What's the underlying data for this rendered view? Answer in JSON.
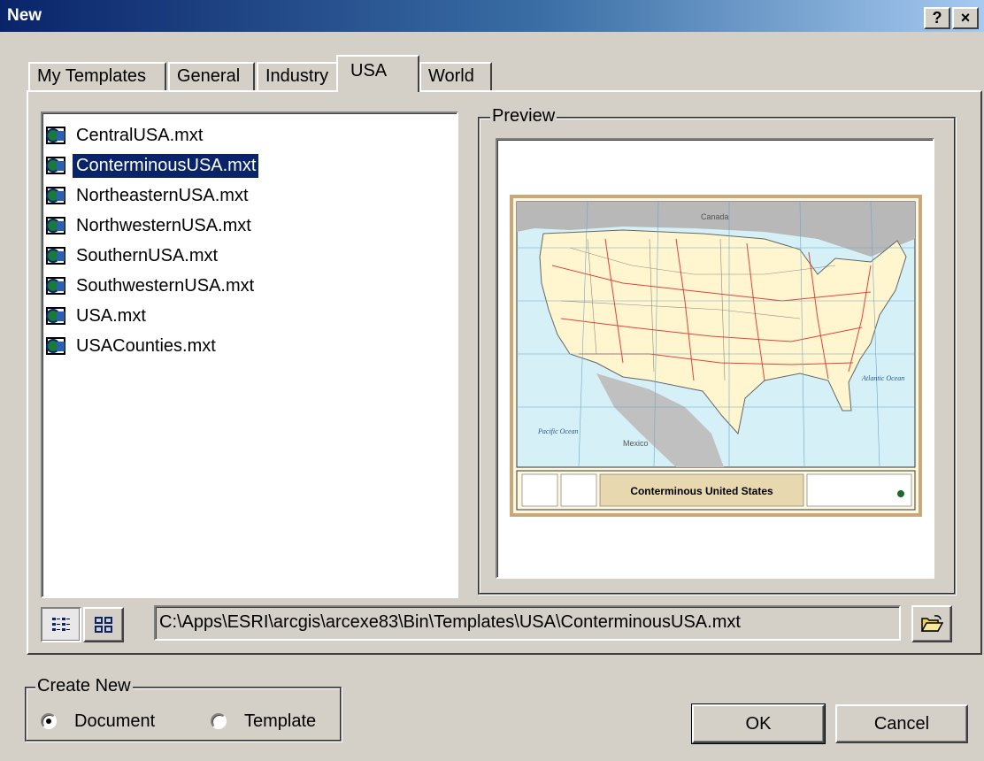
{
  "window": {
    "title": "New",
    "help_label": "?",
    "close_label": "×"
  },
  "tabs": [
    {
      "label": "My Templates"
    },
    {
      "label": "General"
    },
    {
      "label": "Industry"
    },
    {
      "label": "USA",
      "active": true
    },
    {
      "label": "World"
    }
  ],
  "files": [
    {
      "name": "CentralUSA.mxt"
    },
    {
      "name": "ConterminousUSA.mxt",
      "selected": true
    },
    {
      "name": "NortheasternUSA.mxt"
    },
    {
      "name": "NorthwesternUSA.mxt"
    },
    {
      "name": "SouthernUSA.mxt"
    },
    {
      "name": "SouthwesternUSA.mxt"
    },
    {
      "name": "USA.mxt"
    },
    {
      "name": "USACounties.mxt"
    }
  ],
  "preview": {
    "group_label": "Preview",
    "map_title": "Conterminous United States",
    "label_canada": "Canada",
    "label_mexico": "Mexico",
    "label_atlantic": "Atlantic Ocean",
    "label_pacific": "Pacific Ocean"
  },
  "path": "C:\\Apps\\ESRI\\arcgis\\arcexe83\\Bin\\Templates\\USA\\ConterminousUSA.mxt",
  "create_new": {
    "label": "Create New",
    "options": [
      {
        "label": "Document",
        "selected": true
      },
      {
        "label": "Template",
        "selected": false
      }
    ]
  },
  "buttons": {
    "ok": "OK",
    "cancel": "Cancel"
  },
  "colors": {
    "titlebar_start": "#0a246a",
    "selection": "#0a246a",
    "face": "#d4d0c8"
  },
  "icons": [
    "template-file-icon",
    "list-view-icon",
    "large-icons-view-icon",
    "open-folder-icon",
    "help-icon",
    "close-icon"
  ]
}
